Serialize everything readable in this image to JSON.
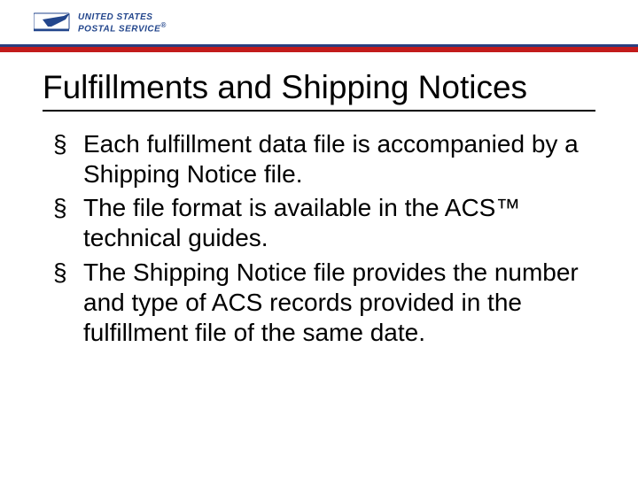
{
  "logo": {
    "line1": "UNITED STATES",
    "line2": "POSTAL SERVICE",
    "reg": "®"
  },
  "title": "Fulfillments and Shipping Notices",
  "bullets": [
    "Each fulfillment data file is accompanied by a Shipping Notice file.",
    "The file format is available in the ACS™ technical guides.",
    "The Shipping Notice file provides the number and type of ACS records provided in the fulfillment file of the same date."
  ]
}
